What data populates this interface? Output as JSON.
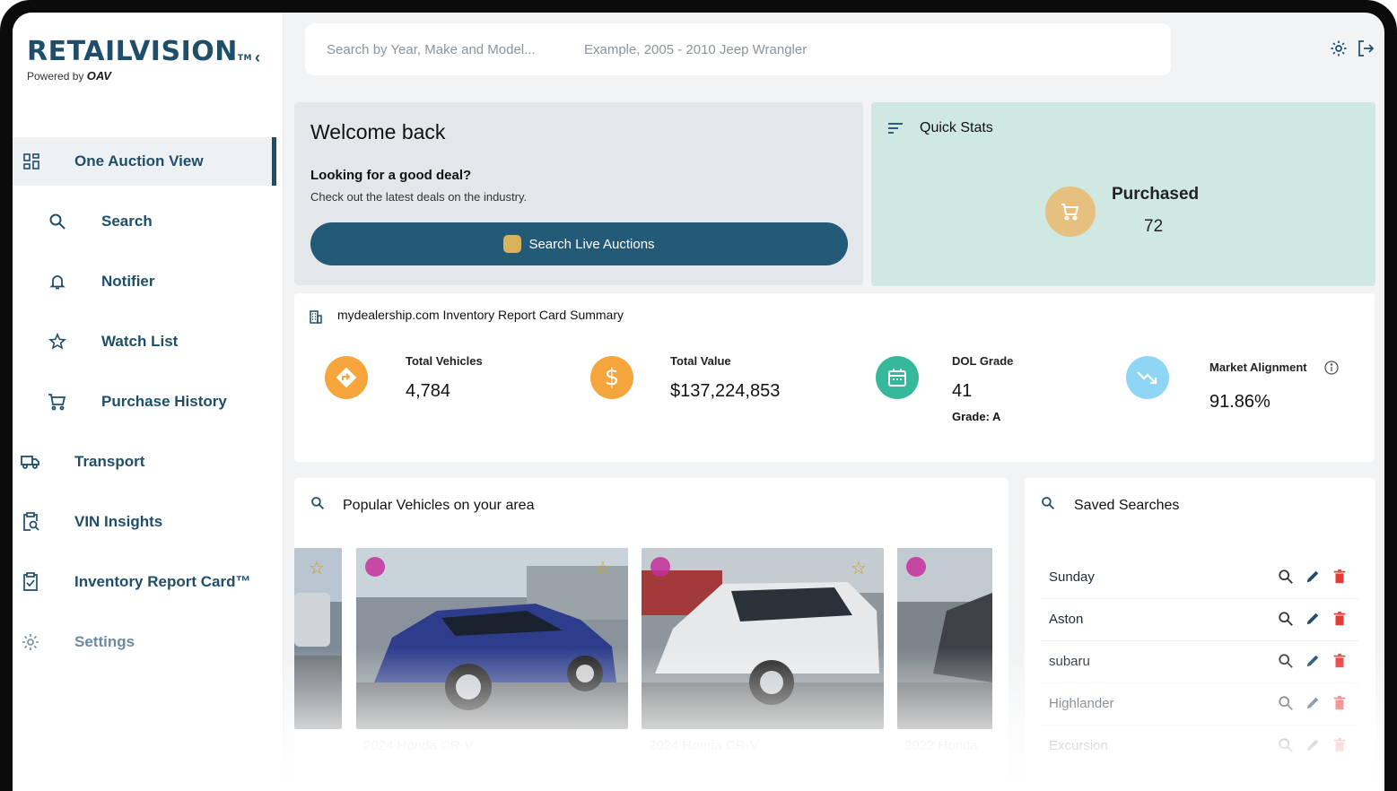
{
  "brand": {
    "name": "RETAILVISION",
    "tm": "TM",
    "powered_prefix": "Powered by",
    "powered_brand": "OAV"
  },
  "sidebar": {
    "collapse_glyph": "‹",
    "items": [
      {
        "label": "One Auction View",
        "icon": "grid-icon",
        "active": true
      },
      {
        "label": "Search",
        "icon": "search-icon"
      },
      {
        "label": "Notifier",
        "icon": "bell-icon"
      },
      {
        "label": "Watch List",
        "icon": "star-icon"
      },
      {
        "label": "Purchase History",
        "icon": "cart-icon"
      },
      {
        "label": "Transport",
        "icon": "truck-icon"
      },
      {
        "label": "VIN Insights",
        "icon": "clipboard-search-icon"
      },
      {
        "label": "Inventory Report Card™",
        "icon": "clipboard-check-icon"
      },
      {
        "label": "Settings",
        "icon": "gear-icon"
      }
    ]
  },
  "search": {
    "placeholder": "Search by Year, Make and Model...",
    "example": "Example, 2005 - 2010 Jeep Wrangler"
  },
  "welcome": {
    "title": "Welcome back",
    "question": "Looking for a good deal?",
    "subtitle": "Check out the latest deals on the industry.",
    "button": "Search Live Auctions"
  },
  "quick_stats": {
    "title": "Quick Stats",
    "purchased_label": "Purchased",
    "purchased_value": "72"
  },
  "report": {
    "title": "mydealership.com Inventory Report Card Summary",
    "total_vehicles_label": "Total Vehicles",
    "total_vehicles_value": "4,784",
    "total_value_label": "Total Value",
    "total_value_value": "$137,224,853",
    "dol_label": "DOL Grade",
    "dol_value": "41",
    "dol_grade": "Grade: A",
    "market_label": "Market Alignment",
    "market_value": "91.86%",
    "colors": {
      "orange": "#f5a53c",
      "teal": "#36b89a",
      "sky": "#8fd6f5"
    }
  },
  "popular": {
    "title": "Popular Vehicles on your area",
    "vehicles": [
      {
        "name": "2024 Honda CR-V"
      },
      {
        "name": "2024 Honda CR-V"
      },
      {
        "name": "2022 Honda"
      }
    ]
  },
  "saved": {
    "title": "Saved Searches",
    "items": [
      "Sunday",
      "Aston",
      "subaru",
      "Highlander",
      "Excursion"
    ]
  },
  "accent": "#1f4e6b"
}
